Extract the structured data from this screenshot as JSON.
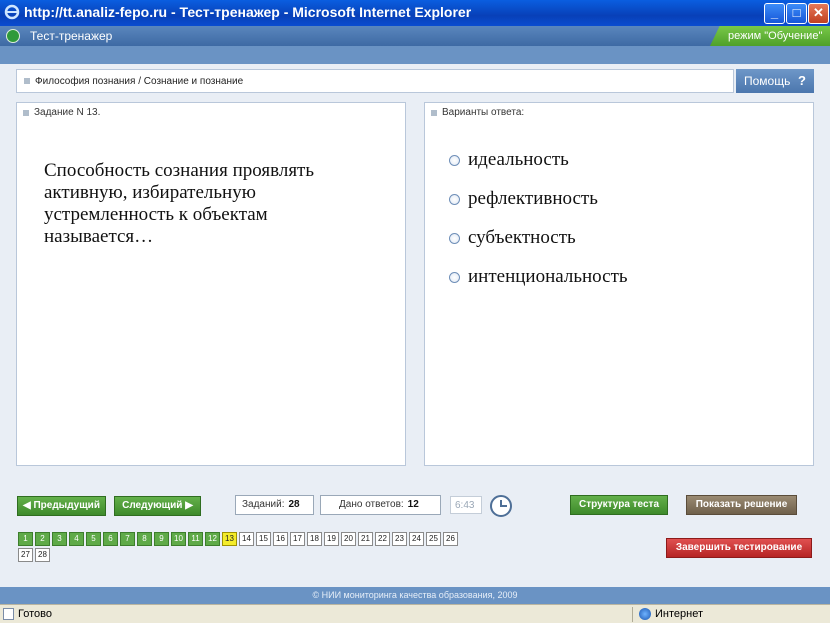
{
  "window": {
    "title": "http://tt.analiz-fepo.ru - Тест-тренажер - Microsoft Internet Explorer",
    "min_label": "_",
    "max_label": "□",
    "close_label": "✕"
  },
  "app": {
    "title": "Тест-тренажер",
    "mode": "режим \"Обучение\""
  },
  "breadcrumb": "Философия познания / Сознание и познание",
  "help": {
    "label": "Помощь",
    "icon": "?"
  },
  "task": {
    "caption": "Задание N 13.",
    "question": "Способность сознания проявлять активную, избирательную устремленность к объектам называется…"
  },
  "answers": {
    "caption": "Варианты ответа:",
    "options": [
      "идеальность",
      "рефлективность",
      "субъектность",
      "интенциональность"
    ]
  },
  "toolbar": {
    "prev": "◀ Предыдущий",
    "next": "Следующий ▶",
    "tasks_label": "Заданий:",
    "tasks_value": "28",
    "answered_label": "Дано ответов:",
    "answered_value": "12",
    "timer": "6:43",
    "structure": "Структура теста",
    "show_solution": "Показать решение",
    "finish": "Завершить тестирование"
  },
  "tasks": {
    "current": 13,
    "done_count": 12,
    "labels": [
      "1",
      "2",
      "3",
      "4",
      "5",
      "6",
      "7",
      "8",
      "9",
      "10",
      "11",
      "12",
      "13",
      "14",
      "15",
      "16",
      "17",
      "18",
      "19",
      "20",
      "21",
      "22",
      "23",
      "24",
      "25",
      "26",
      "27",
      "28"
    ]
  },
  "footer": "© НИИ мониторинга качества образования, 2009",
  "status": {
    "ready": "Готово",
    "zone": "Интернет"
  }
}
